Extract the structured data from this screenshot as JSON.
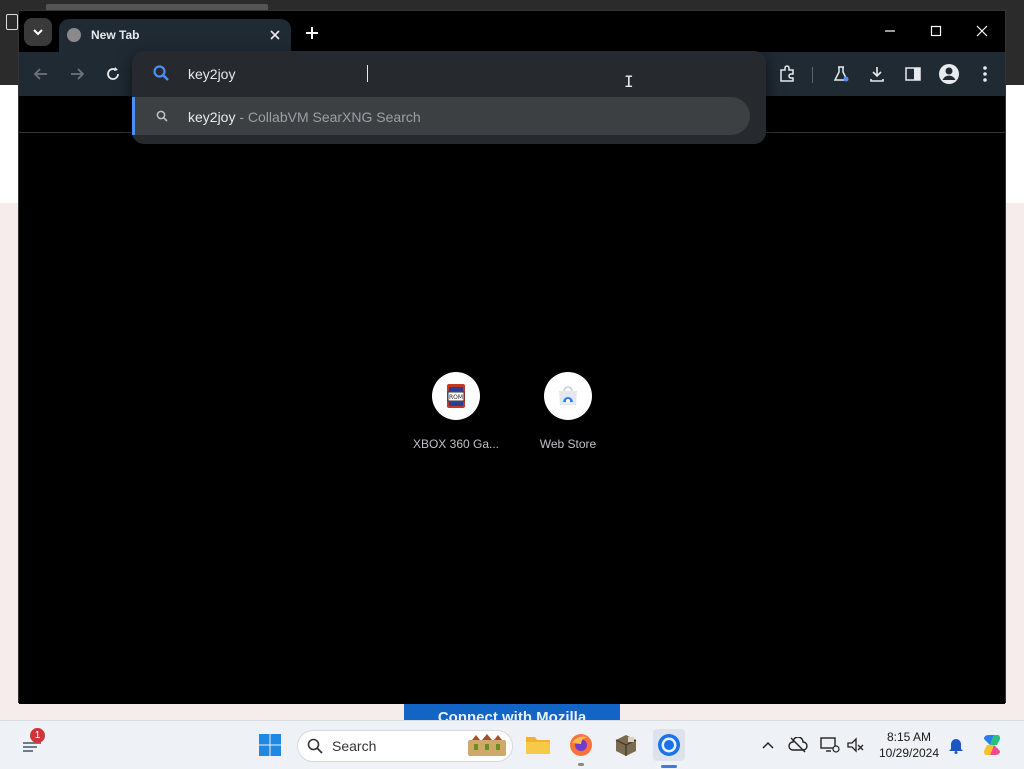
{
  "browser": {
    "tab": {
      "title": "New Tab"
    },
    "omnibox": {
      "value": "key2joy",
      "suggestion": {
        "query": "key2joy",
        "suffix": " - CollabVM SearXNG Search"
      }
    },
    "shortcuts": [
      {
        "label": "XBOX 360 Ga..."
      },
      {
        "label": "Web Store"
      }
    ],
    "accent_color": "#4c8df6"
  },
  "background_page": {
    "button_label": "Connect with Mozilla"
  },
  "taskbar": {
    "search_placeholder": "Search",
    "notification_count": "1",
    "clock": {
      "time": "8:15 AM",
      "date": "10/29/2024"
    }
  }
}
